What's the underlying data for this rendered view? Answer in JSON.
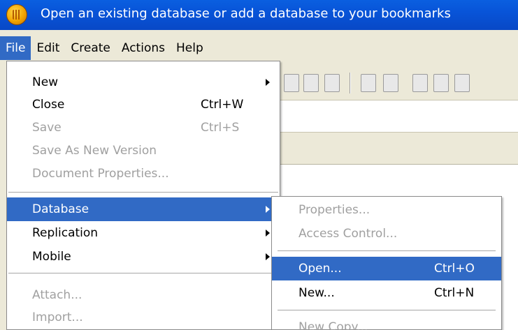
{
  "window": {
    "title": "Open an existing database or add a database to your bookmarks"
  },
  "menubar": {
    "items": [
      {
        "label": "File",
        "active": true
      },
      {
        "label": "Edit"
      },
      {
        "label": "Create"
      },
      {
        "label": "Actions"
      },
      {
        "label": "Help"
      }
    ]
  },
  "file_menu": {
    "items": [
      {
        "label": "New",
        "shortcut": "",
        "submenu": true,
        "enabled": true
      },
      {
        "label": "Close",
        "shortcut": "Ctrl+W",
        "submenu": false,
        "enabled": true
      },
      {
        "label": "Save",
        "shortcut": "Ctrl+S",
        "submenu": false,
        "enabled": false
      },
      {
        "label": "Save As New Version",
        "shortcut": "",
        "submenu": false,
        "enabled": false
      },
      {
        "label": "Document Properties...",
        "shortcut": "",
        "submenu": false,
        "enabled": false
      },
      {
        "label": "Database",
        "shortcut": "",
        "submenu": true,
        "enabled": true,
        "highlighted": true
      },
      {
        "label": "Replication",
        "shortcut": "",
        "submenu": true,
        "enabled": true
      },
      {
        "label": "Mobile",
        "shortcut": "",
        "submenu": true,
        "enabled": true
      },
      {
        "label": "Attach...",
        "shortcut": "",
        "submenu": false,
        "enabled": false
      },
      {
        "label": "Import...",
        "shortcut": "",
        "submenu": false,
        "enabled": false
      }
    ]
  },
  "database_submenu": {
    "items": [
      {
        "label": "Properties...",
        "shortcut": "",
        "enabled": false
      },
      {
        "label": "Access Control...",
        "shortcut": "",
        "enabled": false
      },
      {
        "label": "Open...",
        "shortcut": "Ctrl+O",
        "enabled": true,
        "highlighted": true
      },
      {
        "label": "New...",
        "shortcut": "Ctrl+N",
        "enabled": true
      },
      {
        "label": "New Copy...",
        "shortcut": "",
        "enabled": false
      }
    ]
  },
  "colors": {
    "titlebar": "#0854d8",
    "menu_highlight": "#316ac5",
    "disabled_text": "#a0a0a0",
    "chrome": "#ece9d8"
  }
}
